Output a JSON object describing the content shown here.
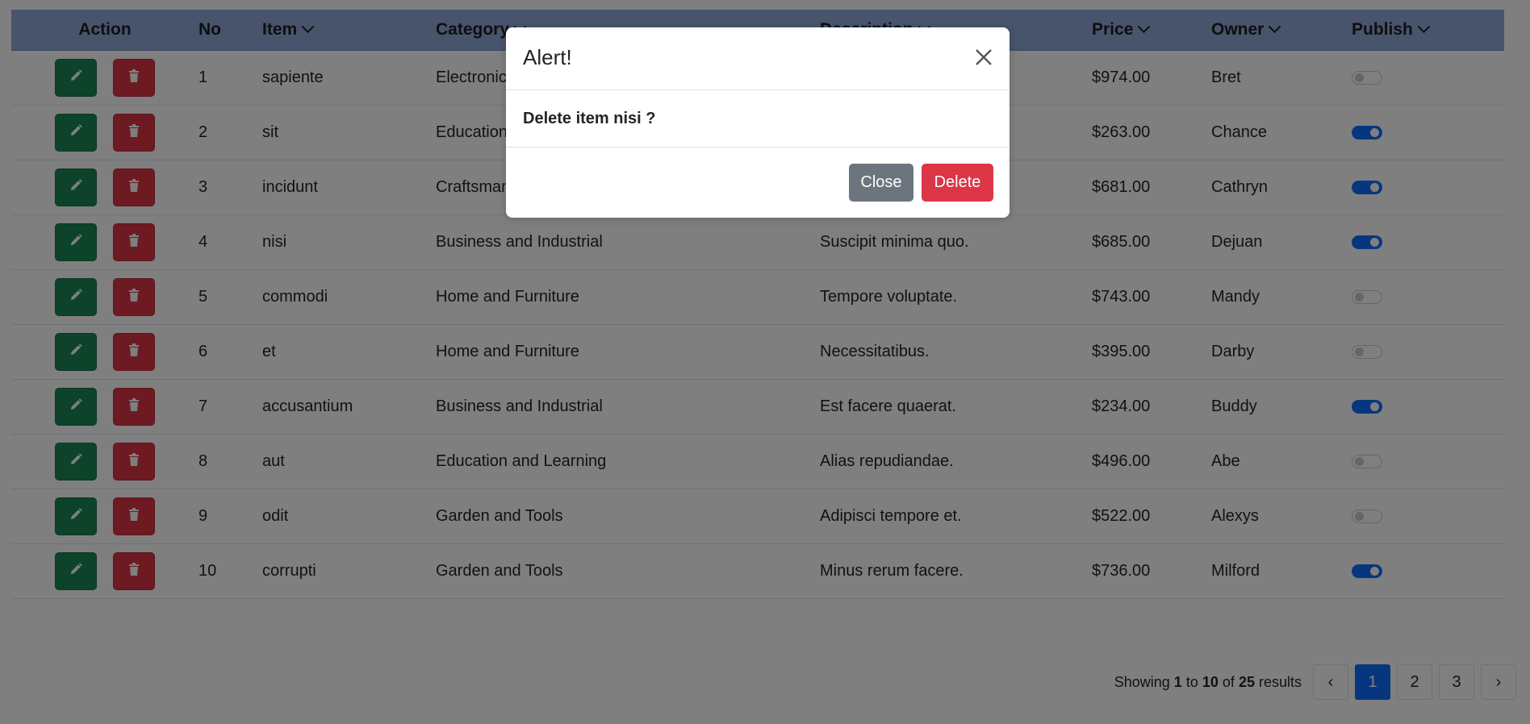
{
  "table": {
    "headers": {
      "action": "Action",
      "no": "No",
      "item": "Item",
      "category": "Category",
      "description": "Description",
      "price": "Price",
      "owner": "Owner",
      "publish": "Publish"
    },
    "rows": [
      {
        "no": "1",
        "item": "sapiente",
        "category": "Electronics",
        "description": "",
        "price": "$974.00",
        "owner": "Bret",
        "published": false
      },
      {
        "no": "2",
        "item": "sit",
        "category": "Education and Learning",
        "description": "",
        "price": "$263.00",
        "owner": "Chance",
        "published": true
      },
      {
        "no": "3",
        "item": "incidunt",
        "category": "Craftsmanship",
        "description": "",
        "price": "$681.00",
        "owner": "Cathryn",
        "published": true
      },
      {
        "no": "4",
        "item": "nisi",
        "category": "Business and Industrial",
        "description": "Suscipit minima quo.",
        "price": "$685.00",
        "owner": "Dejuan",
        "published": true
      },
      {
        "no": "5",
        "item": "commodi",
        "category": "Home and Furniture",
        "description": "Tempore voluptate.",
        "price": "$743.00",
        "owner": "Mandy",
        "published": false
      },
      {
        "no": "6",
        "item": "et",
        "category": "Home and Furniture",
        "description": "Necessitatibus.",
        "price": "$395.00",
        "owner": "Darby",
        "published": false
      },
      {
        "no": "7",
        "item": "accusantium",
        "category": "Business and Industrial",
        "description": "Est facere quaerat.",
        "price": "$234.00",
        "owner": "Buddy",
        "published": true
      },
      {
        "no": "8",
        "item": "aut",
        "category": "Education and Learning",
        "description": "Alias repudiandae.",
        "price": "$496.00",
        "owner": "Abe",
        "published": false
      },
      {
        "no": "9",
        "item": "odit",
        "category": "Garden and Tools",
        "description": "Adipisci tempore et.",
        "price": "$522.00",
        "owner": "Alexys",
        "published": false
      },
      {
        "no": "10",
        "item": "corrupti",
        "category": "Garden and Tools",
        "description": "Minus rerum facere.",
        "price": "$736.00",
        "owner": "Milford",
        "published": true
      }
    ]
  },
  "pagination": {
    "prefix": "Showing",
    "from": "1",
    "to_word": "to",
    "to": "10",
    "of_word": "of",
    "total": "25",
    "suffix": "results",
    "prev": "‹",
    "next": "›",
    "pages": [
      "1",
      "2",
      "3"
    ],
    "current": "1"
  },
  "modal": {
    "title": "Alert!",
    "message": "Delete item nisi ?",
    "close_label": "Close",
    "delete_label": "Delete"
  },
  "icons": {
    "edit": "pencil-icon",
    "delete": "trash-icon",
    "sort": "chevron-down-icon",
    "modal_close": "close-icon"
  },
  "colors": {
    "header_bg": "#8ea9d8",
    "edit_button": "#198754",
    "delete_button": "#dc3545",
    "toggle_on": "#0d6efd",
    "close_button": "#6c757d",
    "active_page": "#0d6efd"
  }
}
